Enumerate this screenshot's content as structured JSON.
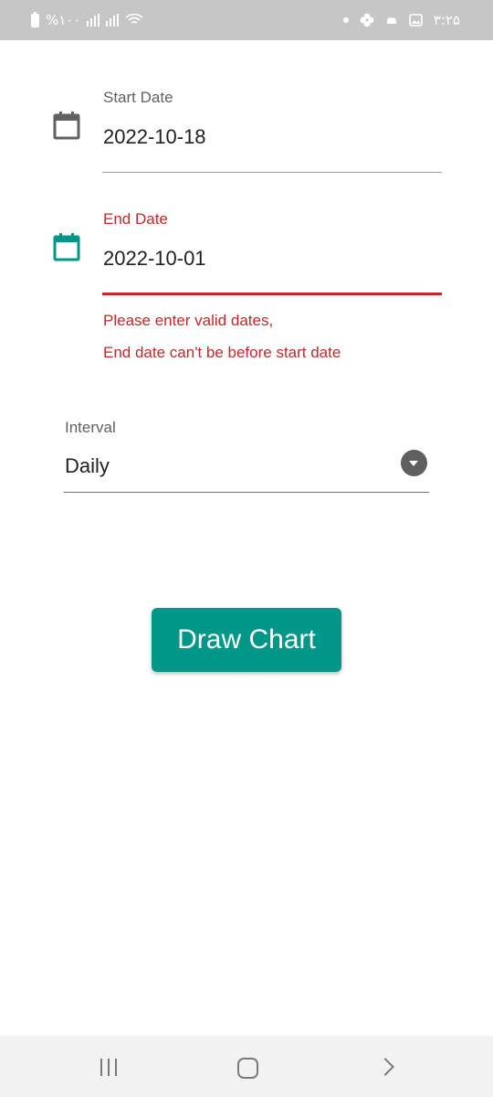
{
  "status_bar": {
    "left_text": "%۱۰۰",
    "time": "۳:۲۵"
  },
  "start_date": {
    "label": "Start Date",
    "value": "2022-10-18",
    "icon": "calendar-icon",
    "label_color": "#616161",
    "icon_color": "#616161"
  },
  "end_date": {
    "label": "End Date",
    "value": "2022-10-01",
    "icon": "calendar-icon",
    "label_color": "#c62828",
    "icon_color": "#009688",
    "error_lines": [
      "Please enter valid dates,",
      "End date can't be before start date"
    ]
  },
  "interval": {
    "label": "Interval",
    "selected": "Daily",
    "icon": "dropdown-arrow-icon"
  },
  "draw_button": {
    "label": "Draw Chart",
    "color": "#009688"
  },
  "colors": {
    "accent": "#009688",
    "error": "#c62828"
  }
}
